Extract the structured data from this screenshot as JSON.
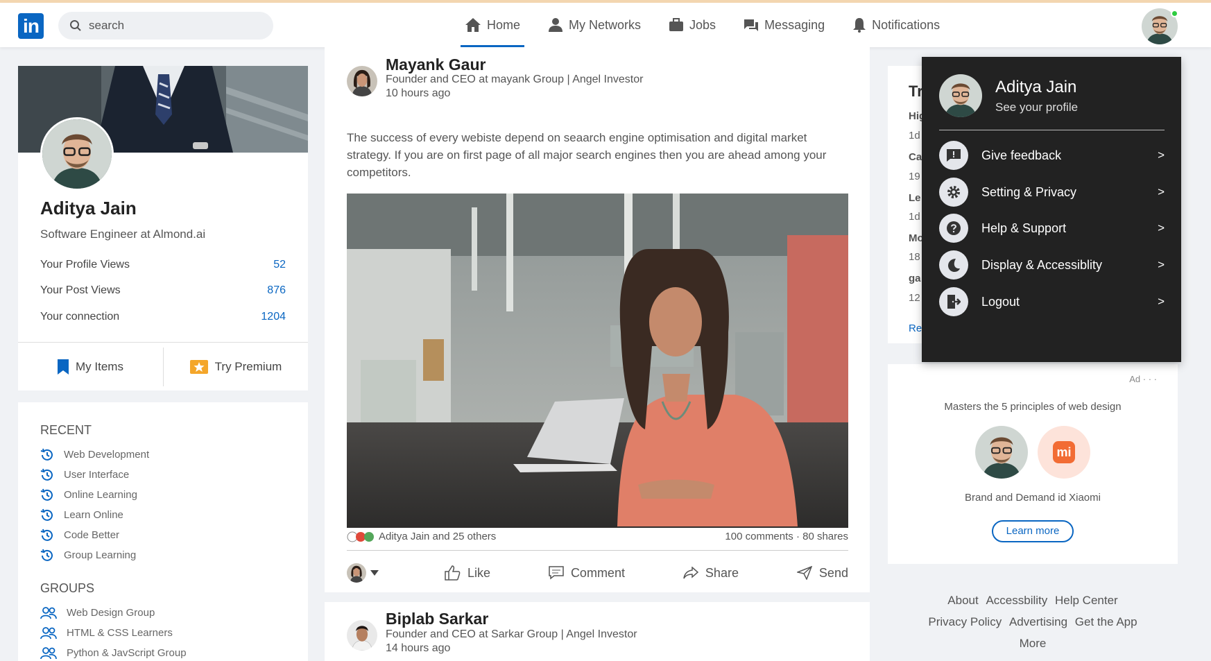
{
  "nav": {
    "logo": "in",
    "search_placeholder": "search",
    "items": [
      {
        "label": "Home",
        "icon": "home-icon"
      },
      {
        "label": "My Networks",
        "icon": "person-icon"
      },
      {
        "label": "Jobs",
        "icon": "briefcase-icon"
      },
      {
        "label": "Messaging",
        "icon": "chat-icon"
      },
      {
        "label": "Notifications",
        "icon": "bell-icon"
      }
    ]
  },
  "profile": {
    "name": "Aditya Jain",
    "title": "Software Engineer at Almond.ai",
    "stats": [
      {
        "label": "Your Profile Views",
        "value": "52"
      },
      {
        "label": "Your Post Views",
        "value": "876"
      },
      {
        "label": "Your connection",
        "value": "1204"
      }
    ],
    "my_items": "My Items",
    "try_premium": "Try Premium"
  },
  "sidebar": {
    "recent_heading": "RECENT",
    "recent": [
      "Web Development",
      "User Interface",
      "Online Learning",
      "Learn Online",
      "Code Better",
      "Group Learning"
    ],
    "groups_heading": "GROUPS",
    "groups": [
      "Web Design Group",
      "HTML & CSS Learners",
      "Python & JavScript Group"
    ]
  },
  "posts": [
    {
      "author": "Mayank Gaur",
      "subtitle": "Founder and CEO at mayank Group | Angel Investor",
      "time": "10 hours ago",
      "text": "The success of every webiste depend on seaarch engine optimisation and digital market strategy. If you are on first page of all major search engines then you are ahead among your competitors.",
      "reactions": "Aditya Jain and 25 others",
      "counts": "100 comments · 80 shares"
    },
    {
      "author": "Biplab Sarkar",
      "subtitle": "Founder and CEO at Sarkar Group | Angel Investor",
      "time": "14 hours ago"
    }
  ],
  "actions": {
    "like": "Like",
    "comment": "Comment",
    "share": "Share",
    "send": "Send"
  },
  "trending": {
    "title_clip": "Tr",
    "rows": [
      "Hig",
      "1d",
      "Ca",
      "19",
      "Le",
      "1d",
      "Mo",
      "18",
      "ga",
      "12"
    ],
    "link_clip": "Re"
  },
  "ad": {
    "tag": "Ad · · ·",
    "headline": "Masters the 5 principles of web design",
    "brand_logo": "mi",
    "caption": "Brand and Demand id Xiaomi",
    "button": "Learn more"
  },
  "footer": {
    "links": [
      "About",
      "Accessbility",
      "Help Center",
      "Privacy Policy",
      "Advertising",
      "Get the App",
      "More"
    ]
  },
  "dropdown": {
    "name": "Aditya Jain",
    "see_profile": "See your profile",
    "items": [
      {
        "label": "Give feedback",
        "icon": "feedback-icon"
      },
      {
        "label": "Setting & Privacy",
        "icon": "gear-icon"
      },
      {
        "label": "Help & Support",
        "icon": "help-icon"
      },
      {
        "label": "Display & Accessiblity",
        "icon": "moon-icon"
      },
      {
        "label": "Logout",
        "icon": "logout-icon"
      }
    ],
    "arrow": ">"
  },
  "colors": {
    "brand": "#0a66c2",
    "dropdown_bg": "#222222",
    "page_bg": "#f0f2f5"
  }
}
